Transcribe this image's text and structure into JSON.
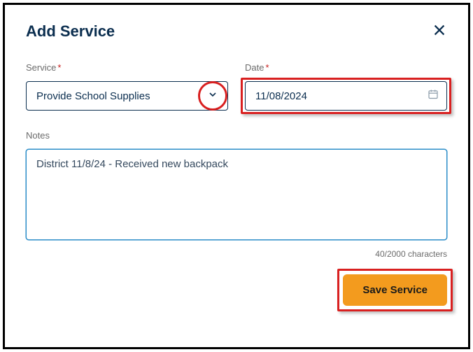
{
  "modal": {
    "title": "Add Service"
  },
  "form": {
    "service": {
      "label": "Service",
      "value": "Provide School Supplies"
    },
    "date": {
      "label": "Date",
      "value": "11/08/2024"
    },
    "notes": {
      "label": "Notes",
      "value": "District 11/8/24 - Received new backpack",
      "counter": "40/2000 characters"
    }
  },
  "buttons": {
    "save": "Save Service"
  }
}
